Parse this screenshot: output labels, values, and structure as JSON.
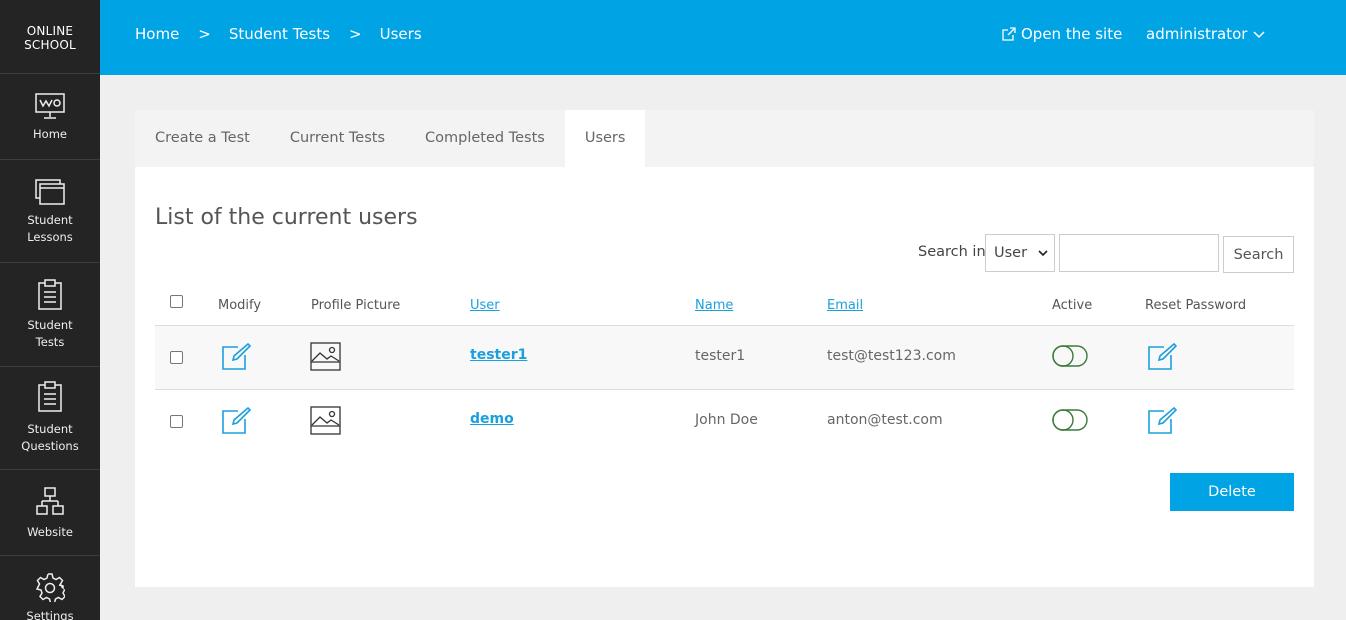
{
  "sidebar": {
    "logo": "ONLINE\nSCHOOL",
    "items": [
      {
        "label": "Home",
        "icon": "presentation-board-icon"
      },
      {
        "label": "Student\nLessons",
        "icon": "windows-icon"
      },
      {
        "label": "Student\nTests",
        "icon": "clipboard-icon"
      },
      {
        "label": "Student\nQuestions",
        "icon": "clipboard-icon"
      },
      {
        "label": "Website",
        "icon": "sitemap-icon"
      },
      {
        "label": "Settings",
        "icon": "gear-icon"
      }
    ]
  },
  "topbar": {
    "breadcrumb": [
      "Home",
      "Student Tests",
      "Users"
    ],
    "separator": ">",
    "open_site": "Open the site",
    "user": "administrator"
  },
  "tabs": [
    "Create a Test",
    "Current Tests",
    "Completed Tests",
    "Users"
  ],
  "active_tab": "Users",
  "main": {
    "title": "List of the current users",
    "search_label": "Search in:",
    "search_field": "User",
    "search_value": "",
    "search_button": "Search",
    "delete_button": "Delete"
  },
  "table": {
    "headers": {
      "modify": "Modify",
      "picture": "Profile Picture",
      "user": "User",
      "name": "Name",
      "email": "Email",
      "active": "Active",
      "reset": "Reset Password"
    },
    "rows": [
      {
        "user": "tester1",
        "name": "tester1",
        "email": "test@test123.com",
        "active": false
      },
      {
        "user": "demo",
        "name": "John Doe",
        "email": "anton@test.com",
        "active": false
      }
    ]
  },
  "colors": {
    "accent": "#00a3e4",
    "sidebar": "#242424",
    "link": "#1aa0dd",
    "toggle": "#3a7a3a"
  }
}
